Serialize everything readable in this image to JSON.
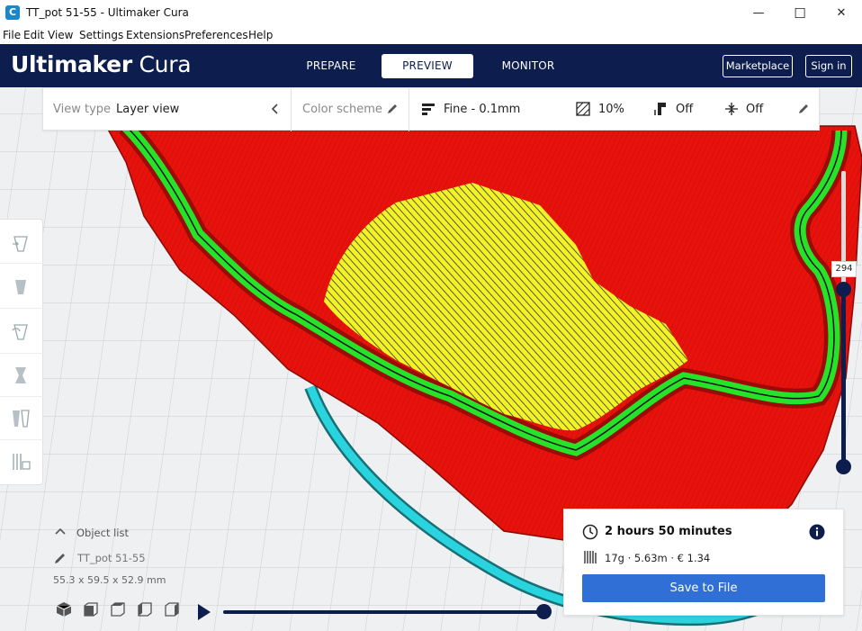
{
  "window": {
    "title": "TT_pot 51-55 - Ultimaker Cura",
    "minimize": "—",
    "maximize": "☐",
    "close": "✕"
  },
  "menu": [
    "File",
    "Edit",
    "View",
    "Settings",
    "Extensions",
    "Preferences",
    "Help"
  ],
  "header": {
    "logo_bold": "Ultimaker",
    "logo_light": "Cura",
    "tabs": [
      "PREPARE",
      "PREVIEW",
      "MONITOR"
    ],
    "active_tab": "PREVIEW",
    "marketplace": "Marketplace",
    "sign_in": "Sign in"
  },
  "view_panel": {
    "view_type_label": "View type",
    "view_type_value": "Layer view",
    "color_scheme_label": "Color scheme",
    "profile": "Fine - 0.1mm",
    "infill": "10%",
    "support": "Off",
    "adhesion": "Off"
  },
  "object": {
    "list_label": "Object list",
    "name": "TT_pot 51-55",
    "dimensions": "55.3 x 59.5 x 52.9 mm"
  },
  "layer_slider": {
    "current_layer": "294",
    "level": 0.6
  },
  "path_slider": {
    "progress": 1.0
  },
  "job": {
    "print_time": "2 hours 50 minutes",
    "material": "17g · 5.63m · € 1.34",
    "save_label": "Save to File"
  },
  "colors": {
    "header": "#0d1d4d",
    "primary": "#2f6fd6",
    "model_red": "#e8120c",
    "wall_green": "#26e32a",
    "infill_yellow": "#f2f227",
    "skirt_cyan": "#2ad4de"
  }
}
